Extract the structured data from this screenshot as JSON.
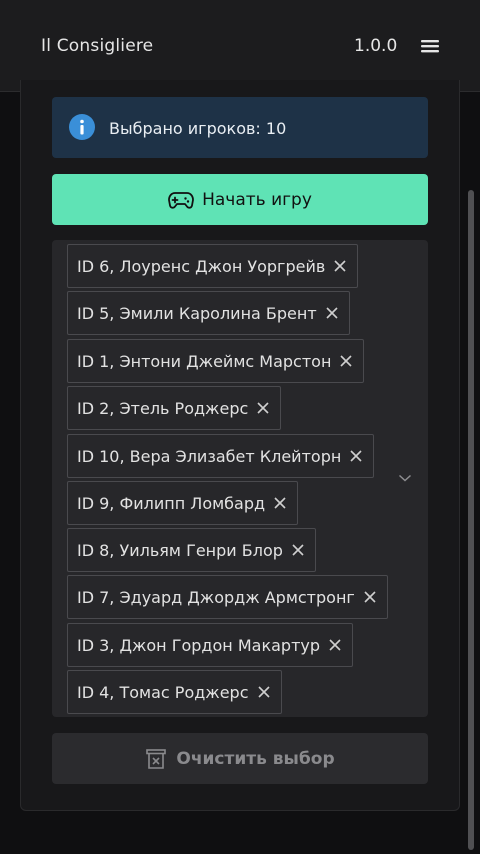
{
  "header": {
    "title": "Il Consigliere",
    "version": "1.0.0",
    "menu_icon": "hamburger-menu-icon"
  },
  "info": {
    "text": "Выбрано игроков: 10",
    "icon": "info-icon",
    "color": "#1e3247"
  },
  "start_button": {
    "label": "Начать игру",
    "icon": "gamepad-icon",
    "color": "#5fe3b5"
  },
  "selected_players": [
    {
      "label": "ID 6, Лоуренс Джон Уоргрейв"
    },
    {
      "label": "ID 5, Эмили Каролина Брент"
    },
    {
      "label": "ID 1, Энтони Джеймс Марстон"
    },
    {
      "label": "ID 2, Этель Роджерс"
    },
    {
      "label": "ID 10, Вера Элизабет Клейторн"
    },
    {
      "label": "ID 9, Филипп Ломбард"
    },
    {
      "label": "ID 8, Уильям Генри Блор"
    },
    {
      "label": "ID 7, Эдуард Джордж Армстронг"
    },
    {
      "label": "ID 3, Джон Гордон Макартур"
    },
    {
      "label": "ID 4, Томас Роджерс"
    }
  ],
  "clear_button": {
    "label": "Очистить выбор",
    "icon": "trash-icon"
  }
}
